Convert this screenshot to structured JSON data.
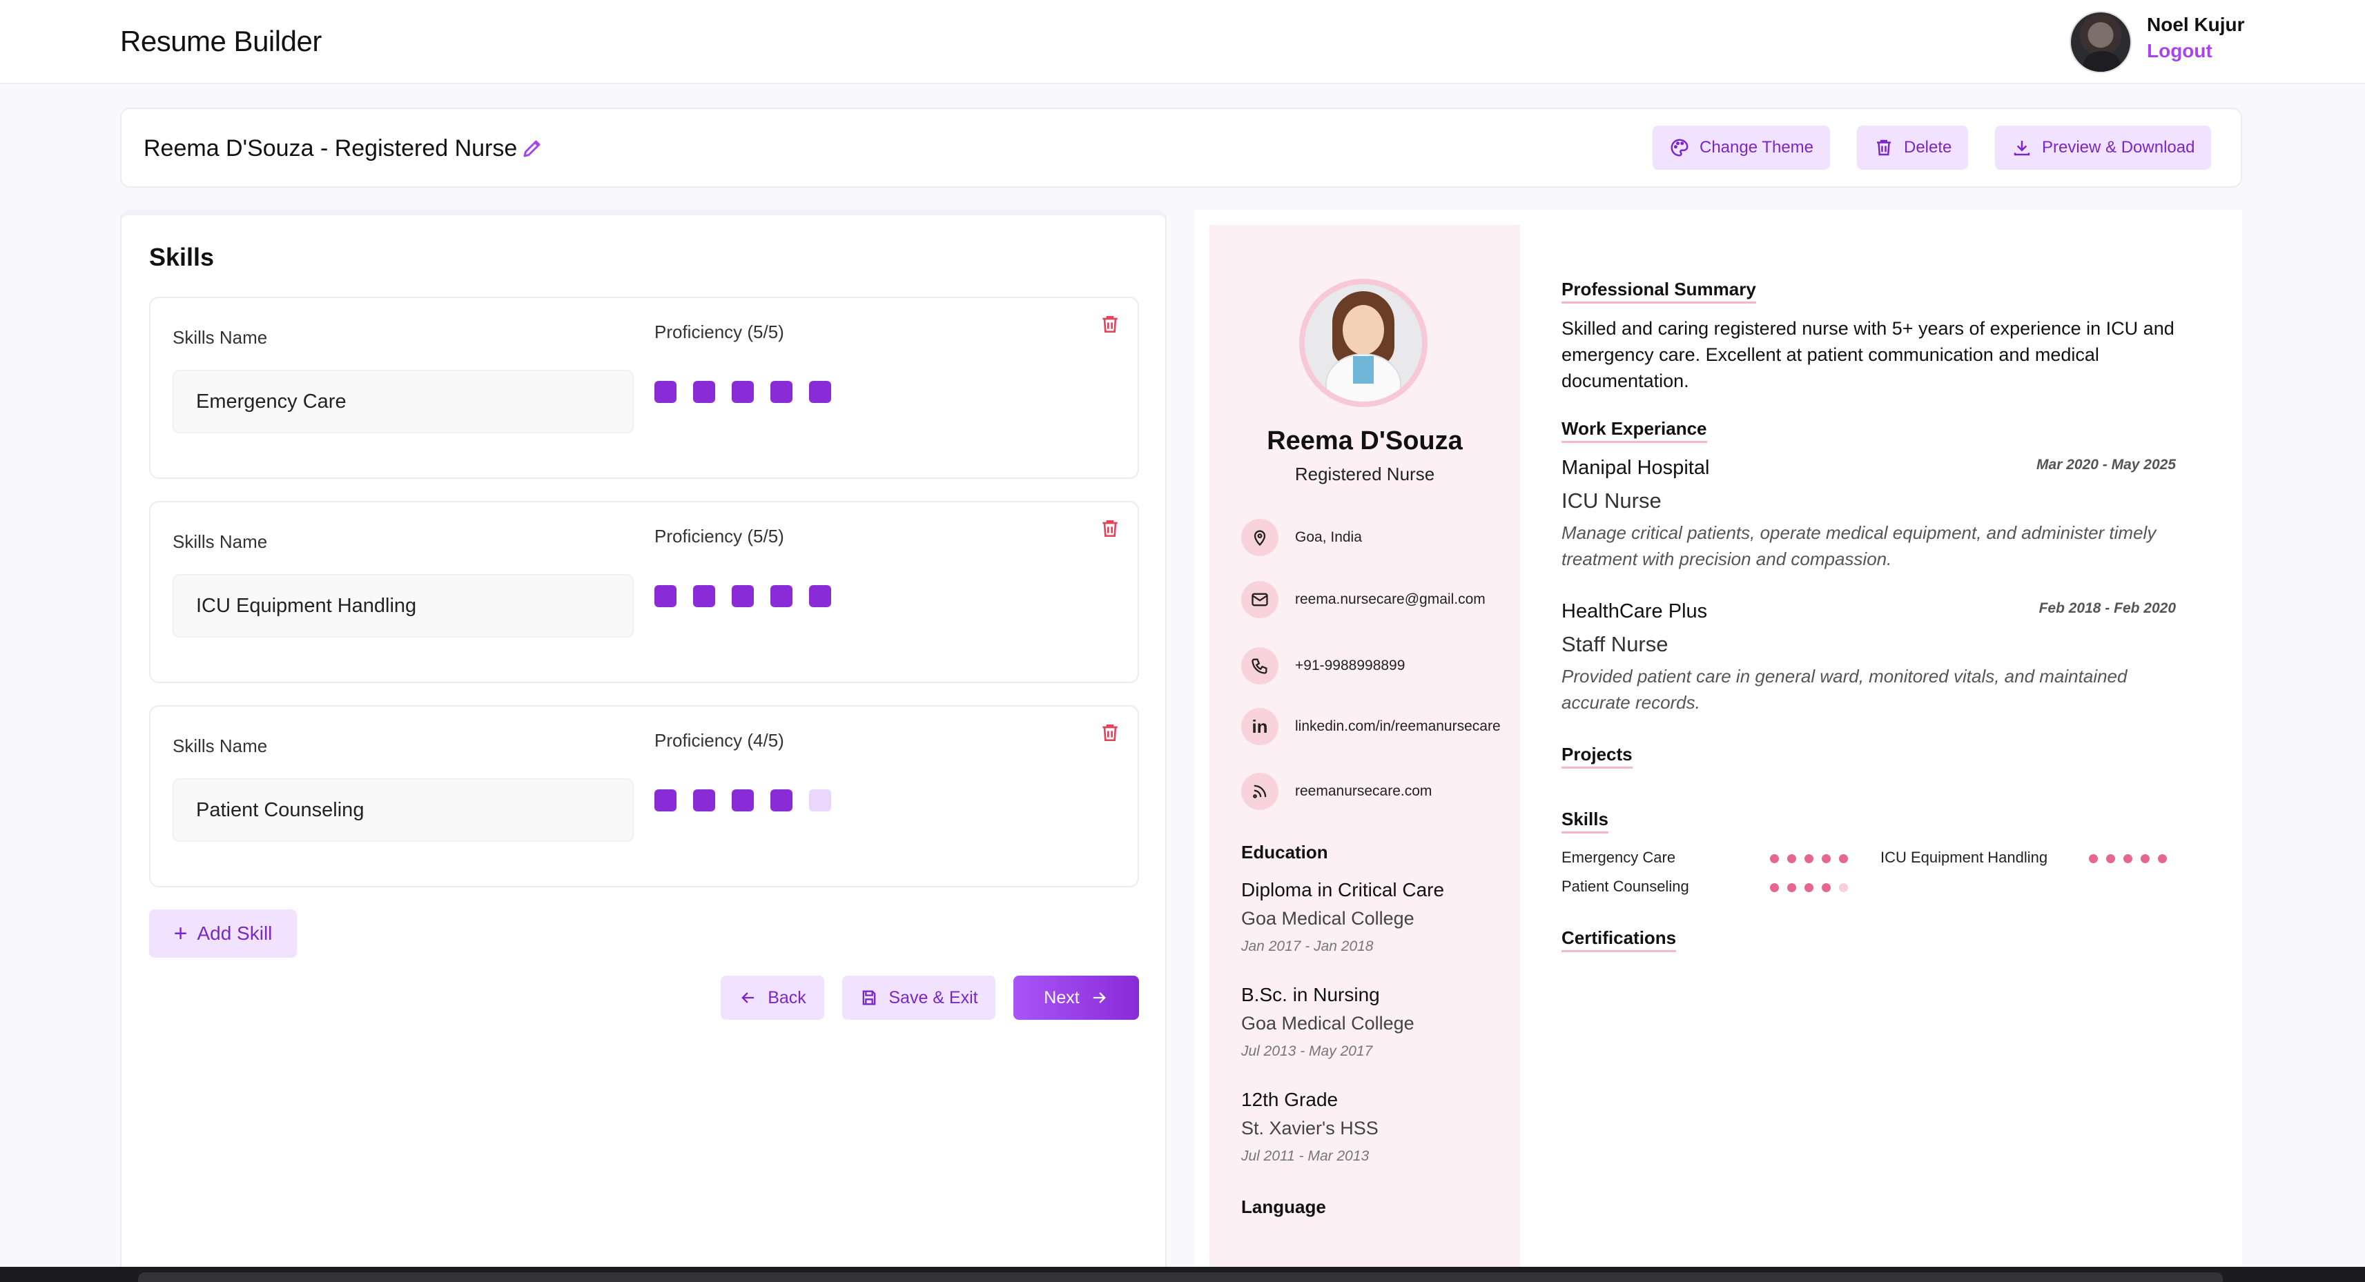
{
  "app": {
    "title": "Resume Builder"
  },
  "user": {
    "name": "Noel Kujur",
    "logout_label": "Logout"
  },
  "resume": {
    "title": "Reema D'Souza - Registered Nurse"
  },
  "toolbar": {
    "change_theme": "Change Theme",
    "delete": "Delete",
    "preview_download": "Preview & Download"
  },
  "editor": {
    "section_title": "Skills",
    "skill_name_label": "Skills Name",
    "skills": [
      {
        "name": "Emergency Care",
        "proficiency_label": "Proficiency (5/5)",
        "level": 5
      },
      {
        "name": "ICU Equipment Handling",
        "proficiency_label": "Proficiency (5/5)",
        "level": 5
      },
      {
        "name": "Patient Counseling",
        "proficiency_label": "Proficiency (4/5)",
        "level": 4
      }
    ],
    "add_skill": "Add Skill",
    "back": "Back",
    "save_exit": "Save & Exit",
    "next": "Next"
  },
  "preview": {
    "name": "Reema D'Souza",
    "role": "Registered Nurse",
    "contacts": {
      "location": "Goa, India",
      "email": "reema.nursecare@gmail.com",
      "phone": "+91-9988998899",
      "linkedin": "linkedin.com/in/reemanursecare",
      "website": "reemanursecare.com"
    },
    "education_heading": "Education",
    "education": [
      {
        "degree": "Diploma in Critical Care",
        "school": "Goa Medical College",
        "dates": "Jan 2017 - Jan 2018"
      },
      {
        "degree": "B.Sc. in Nursing",
        "school": "Goa Medical College",
        "dates": "Jul 2013 - May 2017"
      },
      {
        "degree": "12th Grade",
        "school": "St. Xavier's HSS",
        "dates": "Jul 2011 - Mar 2013"
      }
    ],
    "language_heading": "Language",
    "summary_heading": "Professional Summary",
    "summary": "Skilled and caring registered nurse with 5+ years of experience in ICU and emergency care. Excellent at patient communication and medical documentation.",
    "work_heading": "Work Experiance",
    "jobs": [
      {
        "company": "Manipal Hospital",
        "role": "ICU Nurse",
        "dates": "Mar 2020 - May 2025",
        "description": "Manage critical patients, operate medical equipment, and administer timely treatment with precision and compassion."
      },
      {
        "company": "HealthCare Plus",
        "role": "Staff Nurse",
        "dates": "Feb 2018 - Feb 2020",
        "description": "Provided patient care in general ward, monitored vitals, and maintained accurate records."
      }
    ],
    "projects_heading": "Projects",
    "skills_heading": "Skills",
    "skills": [
      {
        "name": "Emergency Care",
        "level": 5
      },
      {
        "name": "ICU Equipment Handling",
        "level": 5
      },
      {
        "name": "Patient Counseling",
        "level": 4
      }
    ],
    "certifications_heading": "Certifications"
  },
  "colors": {
    "accent": "#8a2bd8",
    "accent_light": "#f1e2ff",
    "preview_accent": "#e7668f",
    "sidebar_bg": "#fdf0f4",
    "danger": "#e0455a"
  }
}
